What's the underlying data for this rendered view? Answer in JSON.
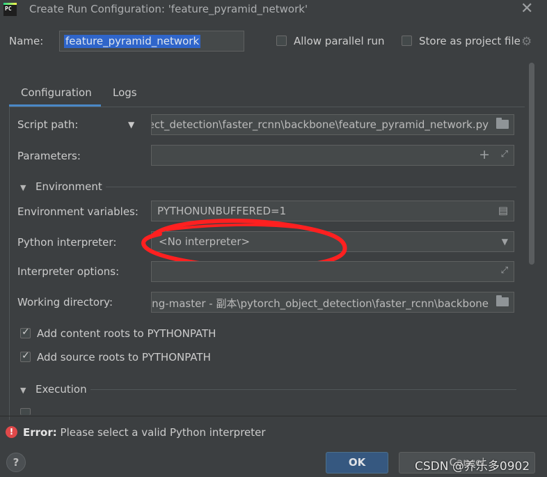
{
  "window": {
    "title": "Create Run Configuration: 'feature_pyramid_network'",
    "close_icon": "close-icon",
    "app_icon_text": "PC"
  },
  "name_row": {
    "label": "Name:",
    "value": "feature_pyramid_network",
    "allow_parallel_label": "Allow parallel run",
    "allow_parallel_checked": false,
    "store_as_project_label": "Store as project file",
    "store_as_project_checked": false
  },
  "tabs": [
    {
      "label": "Configuration",
      "active": true
    },
    {
      "label": "Logs",
      "active": false
    }
  ],
  "form": {
    "script_path": {
      "label": "Script path:",
      "value": "ject_detection\\faster_rcnn\\backbone\\feature_pyramid_network.py"
    },
    "parameters": {
      "label": "Parameters:",
      "value": ""
    },
    "environment_section": "Environment",
    "env_vars": {
      "label": "Environment variables:",
      "value": "PYTHONUNBUFFERED=1"
    },
    "interpreter": {
      "label": "Python interpreter:",
      "value": "<No interpreter>"
    },
    "interpreter_options": {
      "label": "Interpreter options:",
      "value": ""
    },
    "working_dir": {
      "label": "Working directory:",
      "value": "ing-master - 副本\\pytorch_object_detection\\faster_rcnn\\backbone"
    },
    "add_content_roots": {
      "label": "Add content roots to PYTHONPATH",
      "checked": true
    },
    "add_source_roots": {
      "label": "Add source roots to PYTHONPATH",
      "checked": true
    },
    "execution_section": "Execution"
  },
  "error": {
    "prefix": "Error:",
    "message": "Please select a valid Python interpreter"
  },
  "buttons": {
    "help": "?",
    "ok": "OK",
    "cancel": "Cancel"
  },
  "watermark": "CSDN @养乐多0902",
  "colors": {
    "background": "#3c3f41",
    "field": "#45494a",
    "accent": "#4a88c7",
    "selection": "#2f65ca",
    "ok_button": "#365880",
    "error": "#e0494a",
    "annotation": "#ff2020"
  }
}
